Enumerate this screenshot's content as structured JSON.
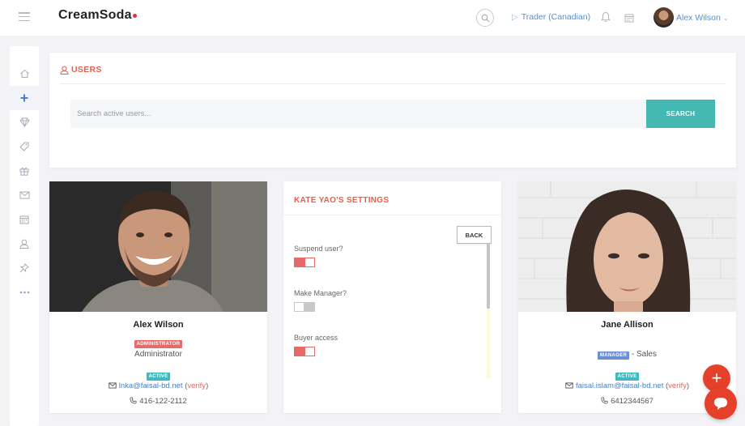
{
  "app": {
    "logo": "CreamSoda",
    "brand_dot_color": "#e03131"
  },
  "header": {
    "account_type": "Trader (Canadian)",
    "user_name": "Alex Wilson"
  },
  "sidebar": {
    "items": [
      {
        "icon": "home-icon"
      },
      {
        "icon": "plus-icon",
        "active": true
      },
      {
        "icon": "diamond-icon"
      },
      {
        "icon": "tag-icon"
      },
      {
        "icon": "gift-icon"
      },
      {
        "icon": "mail-icon"
      },
      {
        "icon": "calendar-icon"
      },
      {
        "icon": "user-icon"
      },
      {
        "icon": "pin-icon"
      },
      {
        "icon": "more-icon"
      }
    ]
  },
  "users": {
    "title": "USERS",
    "search_placeholder": "Search active users...",
    "search_button": "SEARCH"
  },
  "cards": [
    {
      "name": "Alex Wilson",
      "role_badge": "ADMINISTRATOR",
      "role": "Administrator",
      "status": "ACTIVE",
      "email": "lnka@faisal-bd.net",
      "verify": "verify",
      "phone": "416-122-2112"
    },
    {
      "name": "Jane Allison",
      "role_badge": "MANAGER",
      "role": "- Sales",
      "status": "ACTIVE",
      "email": "faisal.islam@faisal-bd.net",
      "verify": "verify",
      "phone": "6412344567"
    }
  ],
  "settings": {
    "title": "KATE YAO'S SETTINGS",
    "back": "BACK",
    "options": [
      {
        "label": "Suspend user?",
        "enabled": true
      },
      {
        "label": "Make Manager?",
        "enabled": false
      },
      {
        "label": "Buyer access",
        "enabled": true
      }
    ]
  },
  "colors": {
    "accent": "#e5604b",
    "teal": "#44b8b3",
    "link": "#4a7fc1",
    "toggle_on": "#e56a6a",
    "fab": "#e5402a"
  }
}
